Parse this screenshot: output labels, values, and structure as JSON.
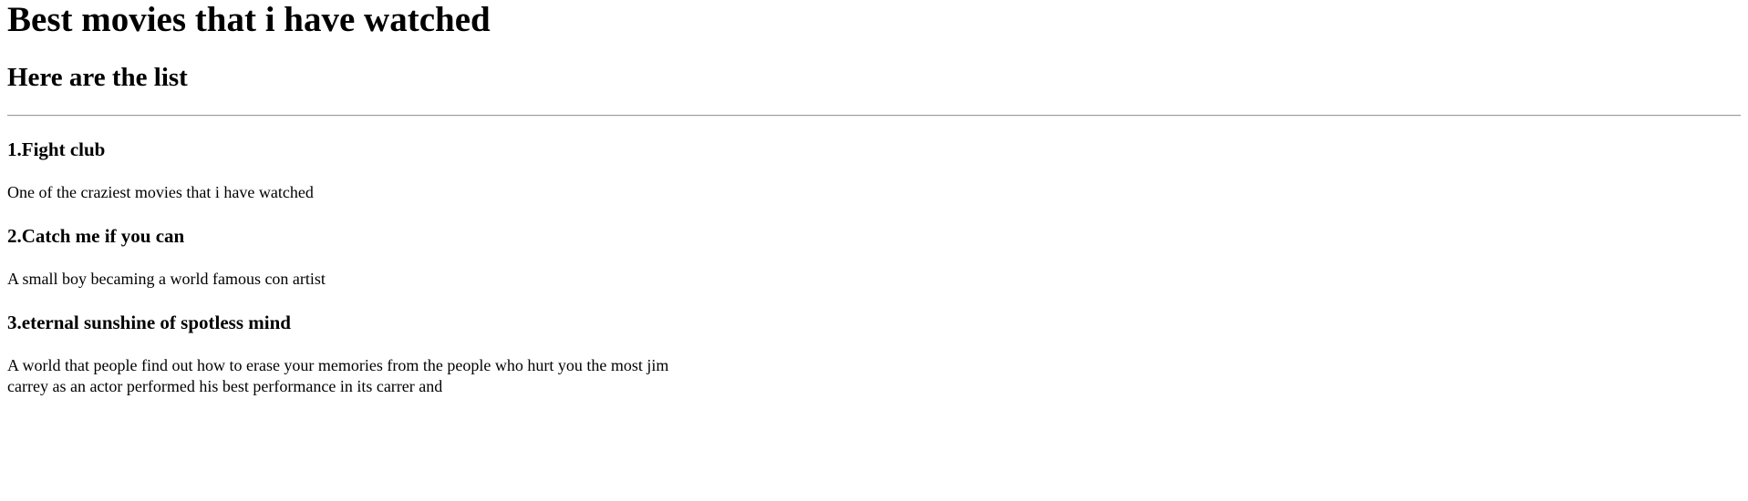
{
  "header": {
    "title": "Best movies that i have watched",
    "subtitle": "Here are the list"
  },
  "movies": [
    {
      "heading": "1.Fight club",
      "description": "One of the craziest movies that i have watched"
    },
    {
      "heading": "2.Catch me if you can",
      "description": "A small boy becaming a world famous con artist"
    },
    {
      "heading": "3.eternal sunshine of spotless mind",
      "description": "A world that people find out how to erase your memories from the people who hurt you the most jim carrey as an actor performed his best performance in its carrer and"
    }
  ]
}
